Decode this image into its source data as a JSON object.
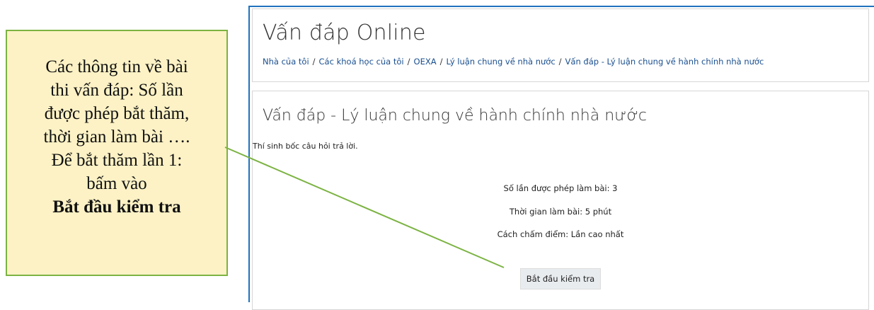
{
  "callout": {
    "lines": [
      "Các thông tin về bài",
      "thi vấn đáp: Số lần",
      "được phép bắt thăm,",
      "thời gian làm bài ….",
      "Để bắt thăm lần 1:",
      "bấm vào"
    ],
    "emphasis": "Bắt đầu kiểm tra"
  },
  "header": {
    "site_title": "Vấn đáp Online",
    "breadcrumb": [
      "Nhà của tôi",
      "Các khoá học của tôi",
      "OEXA",
      "Lý luận chung về nhà nước",
      "Vấn đáp - Lý luận chung về hành chính nhà nước"
    ],
    "separator": "/"
  },
  "quiz": {
    "title": "Vấn đáp - Lý luận chung về hành chính nhà nước",
    "intro": "Thí sinh bốc câu hỏi trả lời.",
    "attempts_allowed": "Số lần được phép làm bài: 3",
    "time_limit": "Thời gian làm bài: 5 phút",
    "grading_method": "Cách chấm điểm: Lần cao nhất",
    "start_button": "Bắt đầu kiểm tra"
  },
  "colors": {
    "callout_bg": "#fdf2c5",
    "callout_border": "#7cb342",
    "connector": "#7cb342",
    "frame_border": "#1e73be",
    "link": "#1a4f8f"
  }
}
